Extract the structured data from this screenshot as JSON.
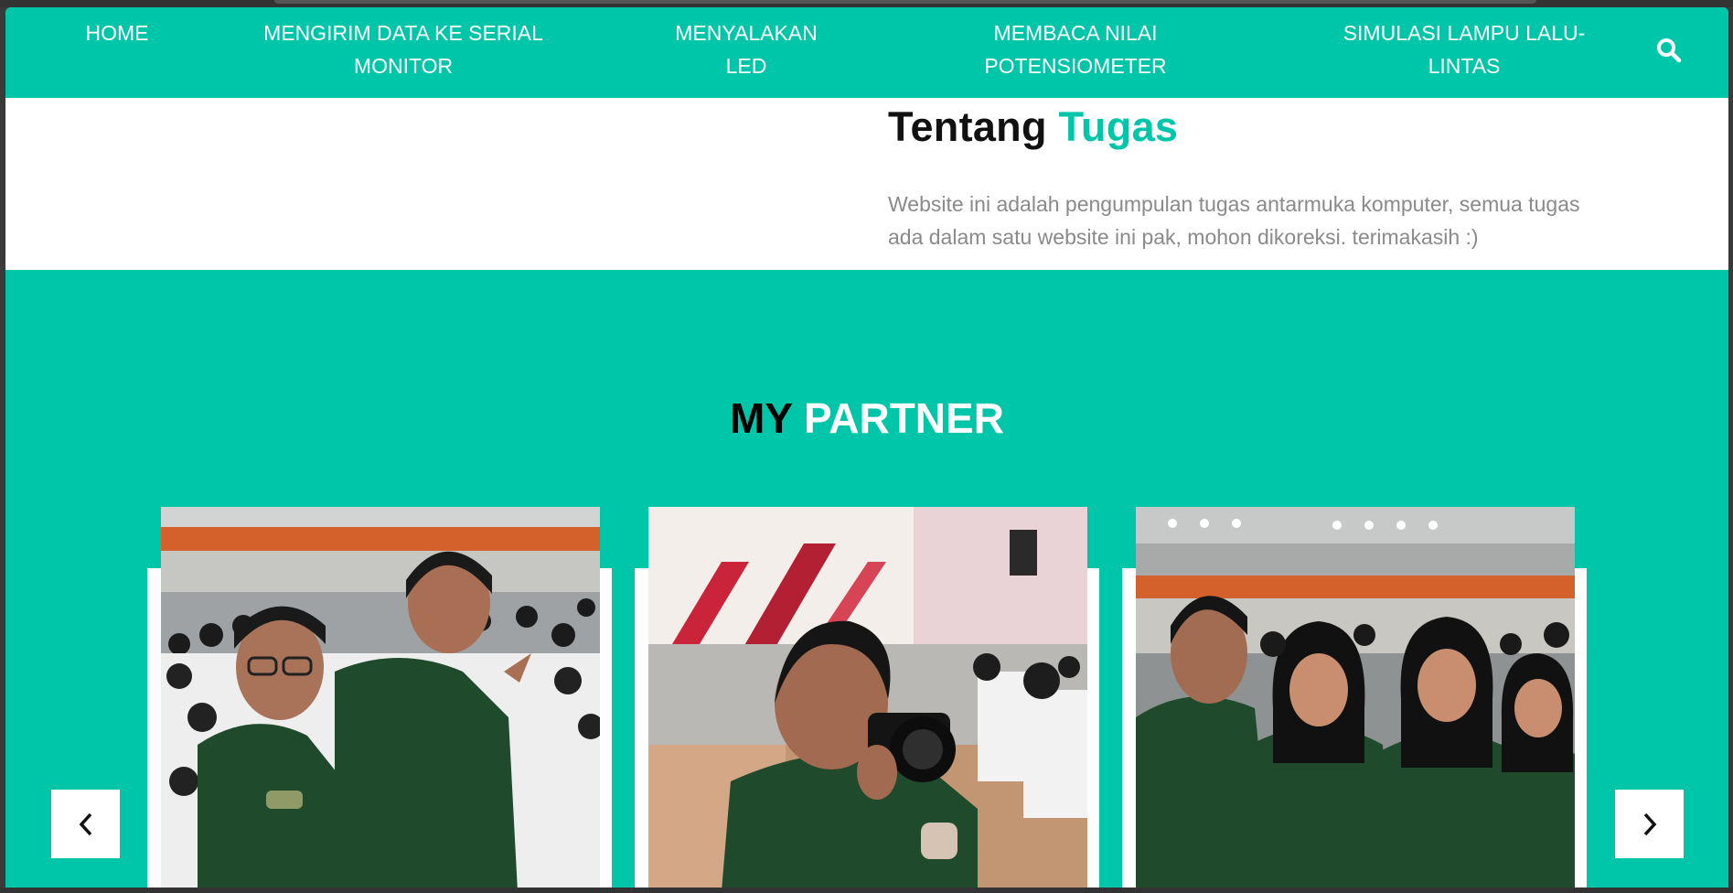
{
  "nav": {
    "items": [
      {
        "label": "HOME"
      },
      {
        "label": "MENGIRIM DATA KE SERIAL\nMONITOR"
      },
      {
        "label": "MENYALAKAN\nLED"
      },
      {
        "label": "MEMBACA NILAI\nPOTENSIOMETER"
      },
      {
        "label": "SIMULASI LAMPU LALU-\nLINTAS"
      }
    ],
    "search_icon": "search-icon"
  },
  "about": {
    "title_main": "Tentang",
    "title_accent": "Tugas",
    "text": "Website ini adalah pengumpulan tugas antarmuka komputer, semua tugas ada dalam satu website ini pak, mohon dikoreksi. terimakasih :)"
  },
  "partner": {
    "title_main": "MY",
    "title_accent": "PARTNER"
  },
  "carousel": {
    "prev_icon": "chevron-left-icon",
    "next_icon": "chevron-right-icon"
  },
  "colors": {
    "accent": "#00c6a9",
    "white": "#ffffff",
    "text_muted": "#8a8a8a",
    "uniform_green": "#1f4a2c"
  }
}
